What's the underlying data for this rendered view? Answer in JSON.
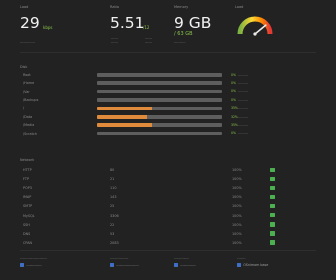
{
  "stats": {
    "speed": {
      "label": "Load",
      "value": "29",
      "unit": "kbps",
      "sub": "-------------"
    },
    "ratio": {
      "label": "Ratio",
      "value": "5.51",
      "unit": "/12",
      "sub1": "------",
      "sub2": "------",
      "sub3": "------",
      "sub4": "------"
    },
    "memory": {
      "label": "Memory",
      "value": "9 GB",
      "unit": "/ 63 GB",
      "sub": "----------"
    },
    "gauge": {
      "label": "Load",
      "level": 0.78
    }
  },
  "disks": {
    "title": "Disk",
    "rows": [
      {
        "name": "Root",
        "fill": 0.0,
        "pct": "0%",
        "size": "---------"
      },
      {
        "name": "/Home",
        "fill": 0.0,
        "pct": "0%",
        "size": "---------"
      },
      {
        "name": "/Var",
        "fill": 0.0,
        "pct": "0%",
        "size": "---------"
      },
      {
        "name": "/Backups",
        "fill": 0.0,
        "pct": "0%",
        "size": "---------"
      },
      {
        "name": "/",
        "fill": 0.44,
        "pct": "35%",
        "size": "---------"
      },
      {
        "name": "/Data",
        "fill": 0.4,
        "pct": "32%",
        "size": "---------"
      },
      {
        "name": "/Media",
        "fill": 0.44,
        "pct": "35%",
        "size": "---------"
      },
      {
        "name": "/Scratch",
        "fill": 0.0,
        "pct": "0%",
        "size": "---------"
      }
    ]
  },
  "network": {
    "title": "Network",
    "rows": [
      {
        "name": "HTTP",
        "value": "80",
        "value2": "100%"
      },
      {
        "name": "FTP",
        "value": "21",
        "value2": "100%"
      },
      {
        "name": "POP3",
        "value": "110",
        "value2": "100%"
      },
      {
        "name": "IMAP",
        "value": "143",
        "value2": "100%"
      },
      {
        "name": "SMTP",
        "value": "25",
        "value2": "100%"
      },
      {
        "name": "MySQL",
        "value": "3306",
        "value2": "100%"
      },
      {
        "name": "SSH",
        "value": "22",
        "value2": "100%"
      },
      {
        "name": "DNS",
        "value": "53",
        "value2": "100%"
      },
      {
        "name": "CPAN",
        "value": "2083",
        "value2": "100%"
      }
    ],
    "status_color": "#4caf50"
  },
  "footer": {
    "columns": [
      {
        "title": "----------------------",
        "link": "-------------"
      },
      {
        "title": "---------------",
        "link": "-------------------"
      },
      {
        "title": "------------",
        "link": "-------------"
      },
      {
        "title": "-------",
        "link": "OSnimom base"
      }
    ]
  },
  "colors": {
    "accent_green": "#8bc34a",
    "bar_fill": "#e08a3c",
    "link_icon": "#3f6fc4"
  }
}
